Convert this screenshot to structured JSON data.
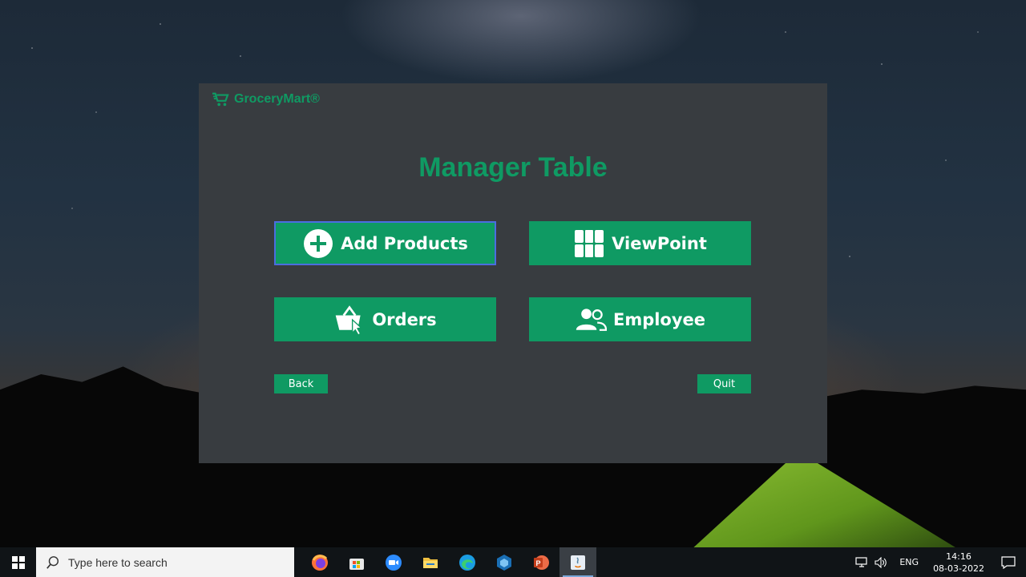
{
  "app": {
    "brand": "GroceryMart®",
    "title": "Manager Table",
    "buttons": {
      "add_products": "Add Products",
      "viewpoint": "ViewPoint",
      "orders": "Orders",
      "employee": "Employee",
      "back": "Back",
      "quit": "Quit"
    },
    "accent_color": "#0f9a63",
    "background_color": "#383c40"
  },
  "taskbar": {
    "search_placeholder": "Type here to search",
    "pinned": [
      "firefox-icon",
      "microsoft-store-icon",
      "zoom-icon",
      "file-explorer-icon",
      "edge-icon",
      "virtualbox-icon",
      "powerpoint-icon",
      "java-app-icon"
    ],
    "language": "ENG",
    "time": "14:16",
    "date": "08-03-2022"
  }
}
